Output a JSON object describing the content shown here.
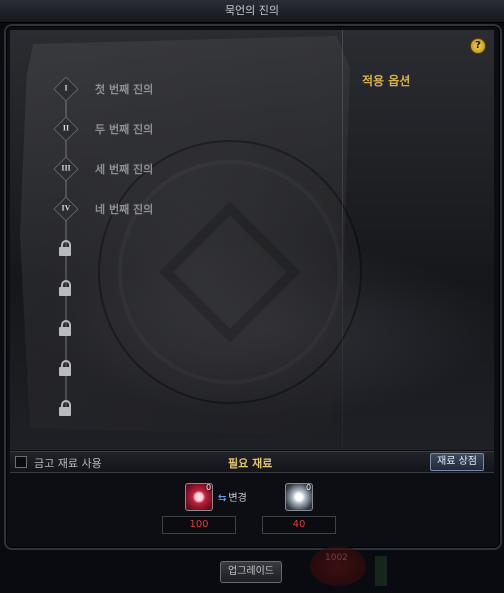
{
  "window": {
    "title": "묵언의 진의"
  },
  "help": {
    "label": "?"
  },
  "options": {
    "title": "적용 옵션"
  },
  "steps": [
    {
      "numeral": "I",
      "label": "첫 번째 진의"
    },
    {
      "numeral": "II",
      "label": "두 번째 진의"
    },
    {
      "numeral": "III",
      "label": "세 번째 진의"
    },
    {
      "numeral": "IV",
      "label": "네 번째 진의"
    }
  ],
  "locked_count": 5,
  "bottom_bar": {
    "storage_checkbox_label": "금고 재료 사용",
    "required_materials_title": "필요 재료",
    "material_shop_label": "재료 상점"
  },
  "materials": {
    "item1": {
      "count": "0",
      "required": "100"
    },
    "change_label": "변경",
    "item2": {
      "count": "0",
      "required": "40"
    }
  },
  "upgrade_button": "업그레이드",
  "background_text": "1002"
}
